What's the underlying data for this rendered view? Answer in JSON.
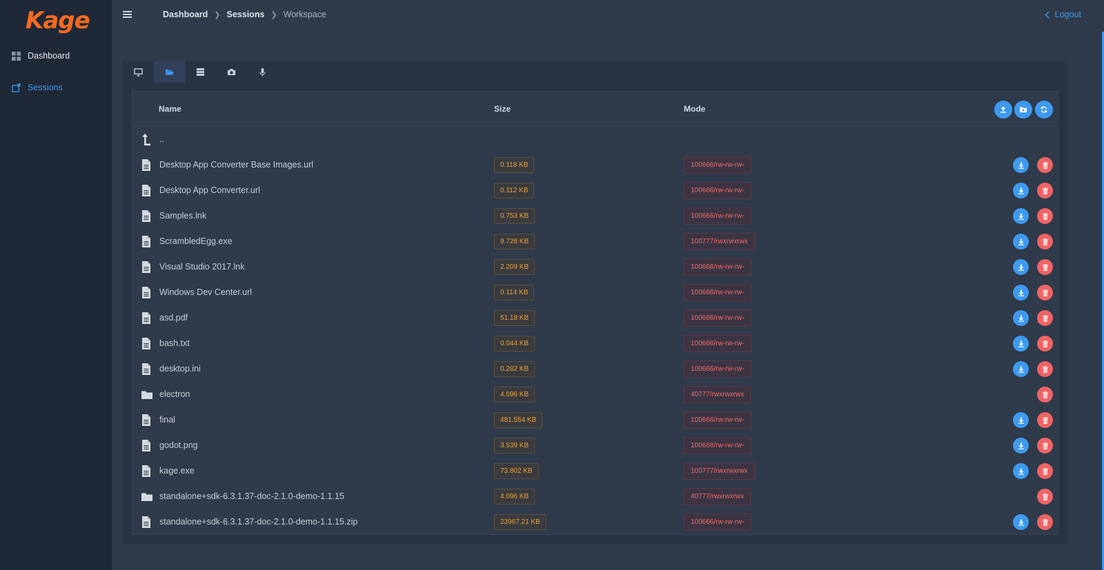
{
  "app": {
    "logo": "Kage"
  },
  "sidebar": {
    "items": [
      {
        "label": "Dashboard",
        "icon": "grid-icon"
      },
      {
        "label": "Sessions",
        "icon": "session-icon",
        "active": true
      }
    ]
  },
  "breadcrumb": [
    "Dashboard",
    "Sessions",
    "Workspace"
  ],
  "header": {
    "logout": "Logout"
  },
  "tabs": [
    {
      "icon": "monitor-icon"
    },
    {
      "icon": "folder-open-icon",
      "active": true
    },
    {
      "icon": "server-icon"
    },
    {
      "icon": "camera-icon"
    },
    {
      "icon": "microphone-icon"
    }
  ],
  "table": {
    "columns": {
      "name": "Name",
      "size": "Size",
      "mode": "Mode"
    },
    "parent": "..",
    "rows": [
      {
        "name": "Desktop App Converter Base Images.url",
        "size": "0.118 KB",
        "mode": "100666/rw-rw-rw-",
        "type": "file"
      },
      {
        "name": "Desktop App Converter.url",
        "size": "0.112 KB",
        "mode": "100666/rw-rw-rw-",
        "type": "file"
      },
      {
        "name": "Samples.lnk",
        "size": "0.753 KB",
        "mode": "100666/rw-rw-rw-",
        "type": "file"
      },
      {
        "name": "ScrambledEgg.exe",
        "size": "9.728 KB",
        "mode": "100777/rwxrwxrwx",
        "type": "file"
      },
      {
        "name": "Visual Studio 2017.lnk",
        "size": "2.209 KB",
        "mode": "100666/rw-rw-rw-",
        "type": "file"
      },
      {
        "name": "Windows Dev Center.url",
        "size": "0.114 KB",
        "mode": "100666/rw-rw-rw-",
        "type": "file"
      },
      {
        "name": "asd.pdf",
        "size": "51.18 KB",
        "mode": "100666/rw-rw-rw-",
        "type": "file"
      },
      {
        "name": "bash.txt",
        "size": "0.044 KB",
        "mode": "100666/rw-rw-rw-",
        "type": "file"
      },
      {
        "name": "desktop.ini",
        "size": "0.282 KB",
        "mode": "100666/rw-rw-rw-",
        "type": "file"
      },
      {
        "name": "electron",
        "size": "4.096 KB",
        "mode": "40777/rwxrwxrwx",
        "type": "folder"
      },
      {
        "name": "final",
        "size": "481.554 KB",
        "mode": "100666/rw-rw-rw-",
        "type": "file"
      },
      {
        "name": "godot.png",
        "size": "3.539 KB",
        "mode": "100666/rw-rw-rw-",
        "type": "file"
      },
      {
        "name": "kage.exe",
        "size": "73.802 KB",
        "mode": "100777/rwxrwxrwx",
        "type": "file"
      },
      {
        "name": "standalone+sdk-6.3.1.37-doc-2.1.0-demo-1.1.15",
        "size": "4.096 KB",
        "mode": "40777/rwxrwxrwx",
        "type": "folder"
      },
      {
        "name": "standalone+sdk-6.3.1.37-doc-2.1.0-demo-1.1.15.zip",
        "size": "23967.21 KB",
        "mode": "100666/rw-rw-rw-",
        "type": "file"
      }
    ]
  },
  "colors": {
    "accent": "#3e9af0",
    "danger": "#ef6466",
    "warning": "#e9a23b",
    "logo": "#f36b21"
  }
}
